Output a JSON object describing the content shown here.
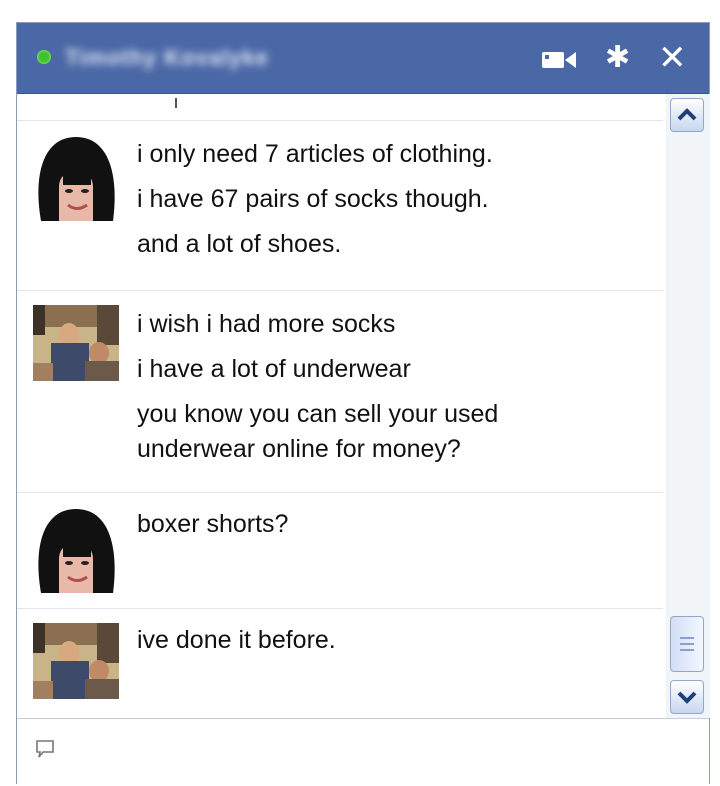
{
  "window": {
    "contact_name": "Timothy Kovalyke",
    "status": "online",
    "status_color": "#43c12f",
    "titlebar_color": "#4b68a6"
  },
  "header_icons": {
    "video": "video-call-icon",
    "settings": "gear-icon",
    "close": "close-icon",
    "close_glyph": "✕",
    "gear_glyph": "✱"
  },
  "messages": [
    {
      "sender_avatar": "cartoon-woman-avatar",
      "lines": [
        "i only need 7 articles of clothing.",
        "i have 67 pairs of socks though.",
        "and a lot of shoes."
      ]
    },
    {
      "sender_avatar": "photo-avatar",
      "lines": [
        "i wish i had more socks",
        "i have a lot of underwear",
        "you know you can sell your used",
        "underwear online for money?"
      ]
    },
    {
      "sender_avatar": "cartoon-woman-avatar",
      "lines": [
        "boxer shorts?"
      ]
    },
    {
      "sender_avatar": "photo-avatar",
      "lines": [
        "ive done it before."
      ]
    }
  ],
  "input": {
    "icon": "compose-icon",
    "value": ""
  }
}
